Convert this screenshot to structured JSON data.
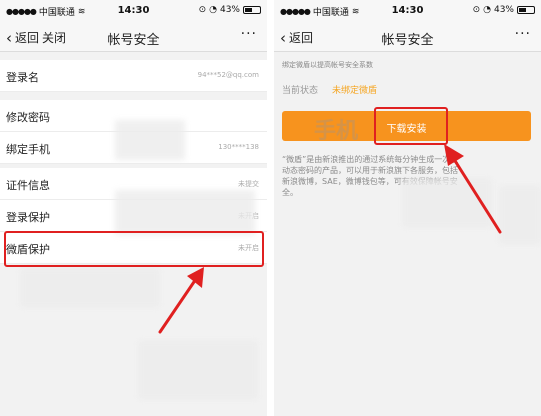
{
  "left": {
    "status": {
      "carrier": "中国联通",
      "time": "14:30",
      "battery": "43%",
      "battery_level": 0.43
    },
    "nav": {
      "back": "返回",
      "close": "关闭",
      "title": "帐号安全",
      "more": "···"
    },
    "rows": [
      {
        "label": "登录名",
        "value": "94***52@qq.com"
      },
      {
        "label": "修改密码",
        "value": ""
      },
      {
        "label": "绑定手机",
        "value": "130****138"
      },
      {
        "label": "证件信息",
        "value": "未提交"
      },
      {
        "label": "登录保护",
        "value": "未开启"
      },
      {
        "label": "微盾保护",
        "value": "未开启"
      }
    ]
  },
  "right": {
    "status": {
      "carrier": "中国联通",
      "time": "14:30",
      "battery": "43%",
      "battery_level": 0.43
    },
    "nav": {
      "back": "返回",
      "title": "帐号安全",
      "more": "···"
    },
    "hint": "绑定微盾以提高帐号安全系数",
    "status_label": "当前状态",
    "status_value": "未绑定微盾",
    "install_label": "下载安装",
    "description": "“微盾”是由新浪推出的通过系统每分钟生成一次性动态密码的产品，可以用于新浪旗下各服务，包括新浪微博，SAE，微博钱包等，可有效保障帐号安全。"
  },
  "colors": {
    "highlight": "#e02020",
    "install_button": "#f7931e",
    "status_value": "#f5a623"
  }
}
